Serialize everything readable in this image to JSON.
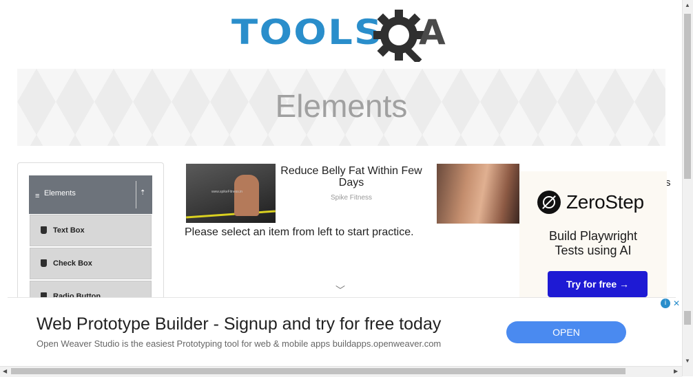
{
  "header": {
    "logo_text_left": "TOOLS",
    "logo_text_right": "A",
    "logo_icon": "gear-magnifier-icon"
  },
  "banner": {
    "title": "Elements"
  },
  "sidebar": {
    "group": {
      "label": "Elements",
      "menu_icon": "hamburger-icon",
      "collapse_icon": "collapse-arrow-icon"
    },
    "items": [
      {
        "label": "Text Box",
        "icon": "html5-icon"
      },
      {
        "label": "Check Box",
        "icon": "html5-icon"
      },
      {
        "label": "Radio Button",
        "icon": "html5-icon"
      }
    ]
  },
  "main": {
    "ad1": {
      "title": "Reduce Belly Fat Within Few Days",
      "source": "Spike Fitness",
      "watermark": "www.spikeFitness.in"
    },
    "instruction": "Please select an item from left to start practice.",
    "scroll_hint_icon": "chevron-down-icon",
    "cut_text": "s"
  },
  "zerostep_ad": {
    "brand": "ZeroStep",
    "line1": "Build Playwright",
    "line2": "Tests using AI",
    "button": "Try for free →"
  },
  "bottom_ad": {
    "title": "Web Prototype Builder - Signup and try for free today",
    "description": "Open Weaver Studio is the easiest Prototyping tool for web & mobile apps buildapps.openweaver.com",
    "button": "OPEN",
    "adchoices_icon": "info-icon",
    "close_icon": "close-icon"
  },
  "colors": {
    "brand_blue": "#2a8ecb",
    "sidebar_header": "#6d737b",
    "menu_item_bg": "#d7d7d7",
    "zerostep_button": "#1e1ad4",
    "open_button": "#4a8af0"
  }
}
